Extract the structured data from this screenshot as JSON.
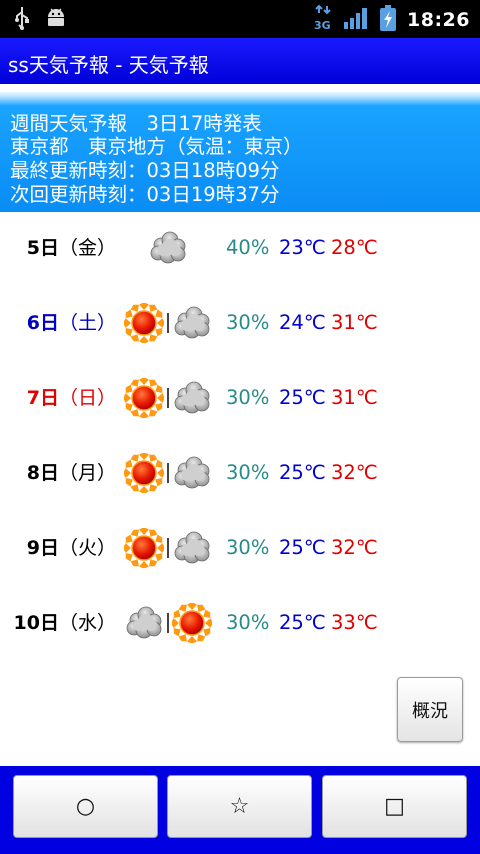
{
  "status_bar": {
    "time": "18:26",
    "network": "3G"
  },
  "title": "ss天気予報 - 天気予報",
  "info": {
    "line1": "週間天気予報　3日17時発表",
    "line2": "東京都　東京地方（気温：東京）",
    "line3": "最終更新時刻：03日18時09分",
    "line4": "次回更新時刻：03日19時37分"
  },
  "forecast": [
    {
      "date": "5日",
      "weekday": "（金）",
      "day_color": "#000000",
      "weather": [
        "cloudy"
      ],
      "pop": "40%",
      "min": "23℃",
      "max": "28℃"
    },
    {
      "date": "6日",
      "weekday": "（土）",
      "day_color": "#0000c0",
      "weather": [
        "sunny",
        "cloudy"
      ],
      "pop": "30%",
      "min": "24℃",
      "max": "31℃"
    },
    {
      "date": "7日",
      "weekday": "（日）",
      "day_color": "#e00000",
      "weather": [
        "sunny",
        "cloudy"
      ],
      "pop": "30%",
      "min": "25℃",
      "max": "31℃"
    },
    {
      "date": "8日",
      "weekday": "（月）",
      "day_color": "#000000",
      "weather": [
        "sunny",
        "cloudy"
      ],
      "pop": "30%",
      "min": "25℃",
      "max": "32℃"
    },
    {
      "date": "9日",
      "weekday": "（火）",
      "day_color": "#000000",
      "weather": [
        "sunny",
        "cloudy"
      ],
      "pop": "30%",
      "min": "25℃",
      "max": "32℃"
    },
    {
      "date": "10日",
      "weekday": "（水）",
      "day_color": "#000000",
      "weather": [
        "cloudy",
        "sunny"
      ],
      "pop": "30%",
      "min": "25℃",
      "max": "33℃"
    }
  ],
  "buttons": {
    "gaikyo": "概況",
    "circle": "○",
    "star": "☆",
    "square": "□"
  },
  "colors": {
    "title_bar": "#0000e0",
    "info_panel": "#0a8cf5",
    "pop": "#2a8a8a",
    "min_temp": "#0000d0",
    "max_temp": "#e00000"
  }
}
